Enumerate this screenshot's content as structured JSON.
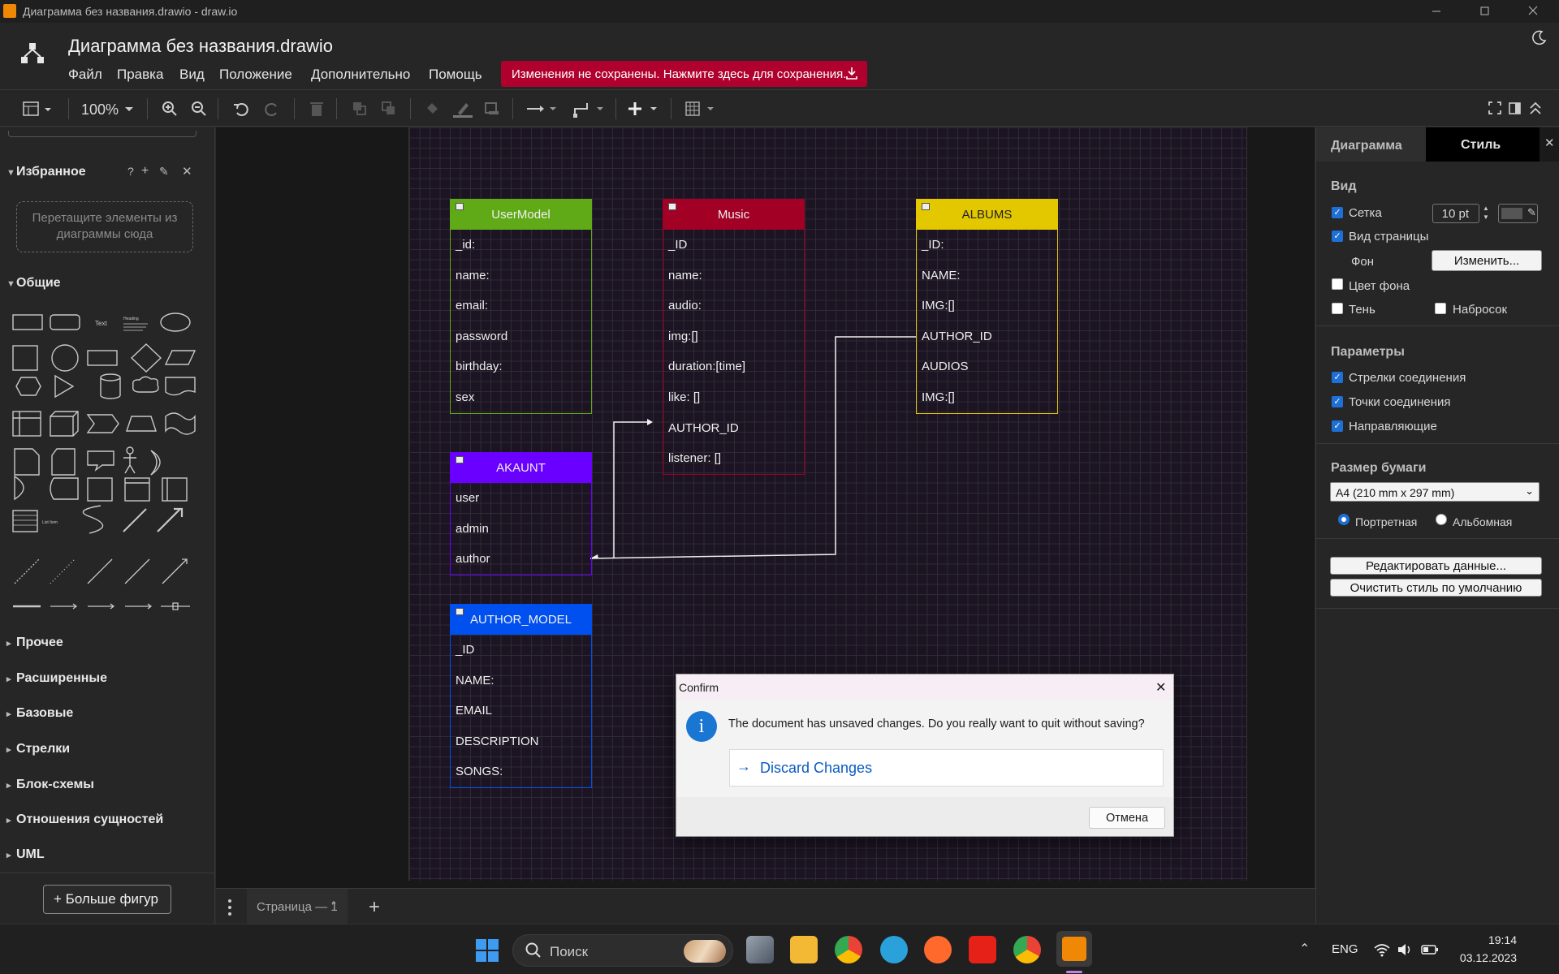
{
  "window": {
    "title": "Диаграмма без названия.drawio - draw.io"
  },
  "header": {
    "file_title": "Диаграмма без названия.drawio",
    "menus": [
      "Файл",
      "Правка",
      "Вид",
      "Положение",
      "Дополнительно",
      "Помощь"
    ],
    "unsaved_banner": "Изменения не сохранены. Нажмите здесь для сохранения."
  },
  "toolbar": {
    "zoom": "100%"
  },
  "left_panel": {
    "favorites": "Избранное",
    "favorites_help": "?",
    "dropzone": "Перетащите элементы из диаграммы сюда",
    "general": "Общие",
    "shape_text": "Text",
    "shape_heading": "Heading",
    "shape_list": "List Item",
    "sections": [
      "Прочее",
      "Расширенные",
      "Базовые",
      "Стрелки",
      "Блок-схемы",
      "Отношения сущностей",
      "UML"
    ],
    "more_shapes": "Больше фигур"
  },
  "entities": [
    {
      "name": "UserModel",
      "color": "#60a917",
      "fields": [
        "_id:",
        "name:",
        "email:",
        "password",
        "birthday:",
        "sex"
      ]
    },
    {
      "name": "Music",
      "color": "#a20025",
      "fields": [
        "_ID",
        "name:",
        "audio:",
        "img:[]",
        "duration:[time]",
        "like: []",
        "AUTHOR_ID",
        "listener: []"
      ]
    },
    {
      "name": "ALBUMS",
      "color": "#e3c800",
      "fields": [
        "_ID:",
        "NAME:",
        "IMG:[]",
        "AUTHOR_ID",
        "AUDIOS",
        "IMG:[]"
      ]
    },
    {
      "name": "AKAUNT",
      "color": "#6a00ff",
      "fields": [
        "user",
        "admin",
        "author"
      ]
    },
    {
      "name": "AUTHOR_MODEL",
      "color": "#0050ef",
      "fields": [
        "_ID",
        "NAME:",
        "EMAIL",
        "DESCRIPTION",
        "SONGS:"
      ]
    }
  ],
  "page_bar": {
    "page": "Страница — 1"
  },
  "right_panel": {
    "tab_diagram": "Диаграмма",
    "tab_style": "Стиль",
    "view_heading": "Вид",
    "grid": "Сетка",
    "grid_size": "10 pt",
    "page_view": "Вид страницы",
    "background": "Фон",
    "change": "Изменить...",
    "bg_color": "Цвет фона",
    "shadow": "Тень",
    "sketch": "Набросок",
    "params_heading": "Параметры",
    "connection_arrows": "Стрелки соединения",
    "connection_points": "Точки соединения",
    "guides": "Направляющие",
    "paper_heading": "Размер бумаги",
    "paper_size": "A4 (210 mm x 297 mm)",
    "portrait": "Портретная",
    "landscape": "Альбомная",
    "edit_data": "Редактировать данные...",
    "clear_style": "Очистить стиль по умолчанию"
  },
  "dialog": {
    "title": "Confirm",
    "message": "The document has unsaved changes. Do you really want to quit without saving?",
    "discard": "Discard Changes",
    "cancel": "Отмена"
  },
  "taskbar": {
    "search": "Поиск",
    "lang": "ENG",
    "time": "19:14",
    "date": "03.12.2023"
  }
}
